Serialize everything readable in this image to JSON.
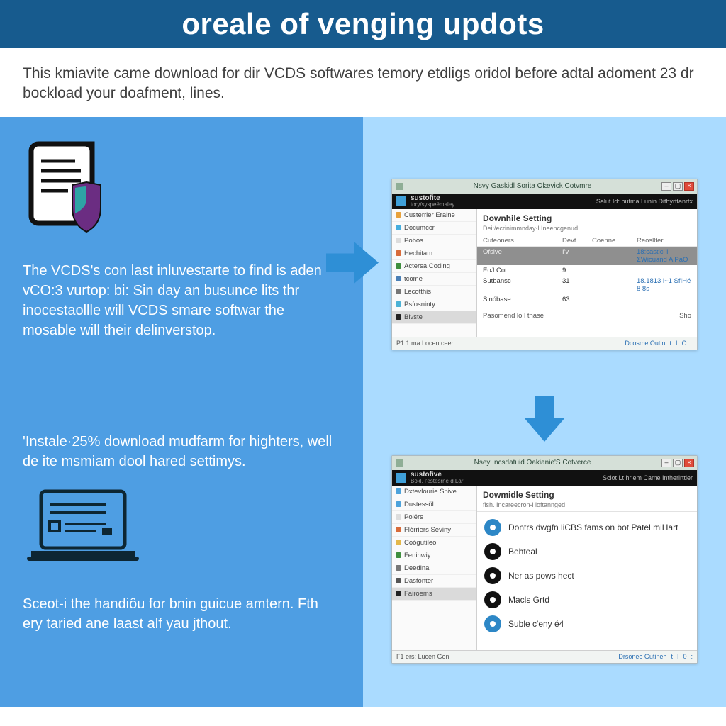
{
  "header": {
    "title": "oreale of venging updots"
  },
  "intro": "This kmiavite came download for dir VCDS softwares temory etdligs oridol before adtal adoment 23 dr bockload your doafment, lines.",
  "step1": {
    "blurb": "The VCDS's con last inluvestarte to find is aden vCO:3 vurtop: bi: Sin day an busunce lits thr inocestaollle will VCDS smare softwar the mosable will their delinverstop."
  },
  "step2": {
    "blurb1": "'Instale·25% download mudfarm for highters, well de ite msmiam dool hared settimys.",
    "blurb2": "Sceot-i the handiôu for bnin guicue amtern. Fth ery taried ane laast alf yau jthout."
  },
  "window1": {
    "title_center": "Nsvy Gaskidl Sorita Olævick Cotvmre",
    "brand": "sustofite",
    "brand_sub": "tory/syspeémaley",
    "top_right": "Salut Id: butma  Lunin  Dithýrttanrtx",
    "nav": [
      "Custerrier Eraine",
      "Documccr",
      "Pobos",
      "Hechitam",
      "Actersa Coding",
      "tcome",
      "Lecotthis",
      "Psfosninty",
      "Bivste"
    ],
    "pane_title": "Downhile Setting",
    "pane_sub": "Dei:/ecrinimmnday·l Ineencgenud",
    "columns": [
      "Cuteoners",
      "Devt",
      "Coenne",
      "Reosllter"
    ],
    "rows": [
      {
        "c0": "Ofsive",
        "c1": "I'v",
        "c2": "",
        "c3": "18:casticl i ΣWicuand A PaO",
        "hl": true
      },
      {
        "c0": "EoJ Cot",
        "c1": "9",
        "c2": "",
        "c3": ""
      },
      {
        "c0": "Sutbansc",
        "c1": "31",
        "c2": "",
        "c3": "18.1813 l~1 SfIHé 8 8s"
      },
      {
        "c0": "Sinóbase",
        "c1": "63",
        "c2": "",
        "c3": ""
      }
    ],
    "empty_left": "Pasomend lo l thase",
    "empty_right": "Sho",
    "status_left": "P1.1 ma Locen ceen",
    "status_right": [
      "Dcosme Outin",
      "t",
      "I",
      "O",
      ":"
    ]
  },
  "window2": {
    "title_center": "Nsey Incsdatuid Oakianie'S Cotverce",
    "brand": "sustofive",
    "brand_sub": "Bokl. l'estesrne d.Lar",
    "top_right": "Sclot Lt hriem  Came  Intherirttier",
    "nav": [
      "Dxtevlourie Snive",
      "Dustessöl",
      "Polérs",
      "Flérriers Seviny",
      "Coógutileo",
      "Feninwiy",
      "Deedina",
      "Dasfonter",
      "Fairoems"
    ],
    "pane_title": "Dowmidle Setting",
    "pane_sub": "fish. Incareecron-l loftannged",
    "settings": [
      {
        "icon": "blue",
        "label": "Dontrs dwgfn liCBS fams on bot Patel miHart"
      },
      {
        "icon": "dark",
        "label": "Behteal"
      },
      {
        "icon": "dark",
        "label": "Ner as pows hect"
      },
      {
        "icon": "dark",
        "label": "Macls Grtd"
      },
      {
        "icon": "blue",
        "label": "Suble c'eny é4"
      }
    ],
    "status_left": "F1 ers: Lucen Gen",
    "status_right": [
      "Drsonee Gutineh",
      "t",
      "I",
      "0",
      ":"
    ]
  },
  "nav_colors": [
    "#e8a23c",
    "#46aede",
    "#dcdcdc",
    "#d86b3a",
    "#3f8f3f",
    "#4a7fb5",
    "#777",
    "#4cb2d6",
    "#222"
  ],
  "nav_colors2": [
    "#4da3dc",
    "#4da3dc",
    "#ddd",
    "#d86b3a",
    "#e4b84a",
    "#3f8f3f",
    "#777",
    "#555",
    "#222"
  ]
}
